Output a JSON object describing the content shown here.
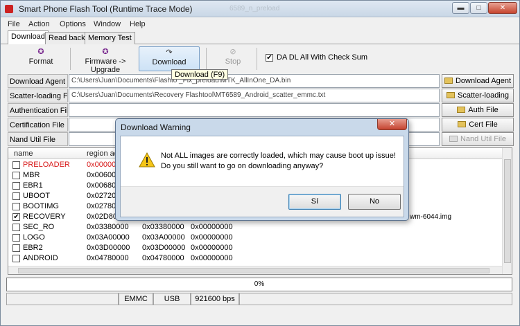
{
  "window": {
    "title": "Smart Phone Flash Tool (Runtime Trace Mode)",
    "ghost_text": "6589_n_preload",
    "min_glyph": "▬",
    "max_glyph": "□",
    "close_glyph": "✕"
  },
  "menu": [
    "File",
    "Action",
    "Options",
    "Window",
    "Help"
  ],
  "tabs": [
    "Download",
    "Read back",
    "Memory Test"
  ],
  "toolbar": {
    "format": "Format",
    "firmware_upgrade": "Firmware -> Upgrade",
    "download": "Download",
    "stop": "Stop",
    "da_dl_checkbox": "DA DL All With Check Sum",
    "da_dl_checked": "✔",
    "tooltip": "Download (F9)"
  },
  "file_rows": [
    {
      "label": "Download Agent",
      "value": "C:\\Users\\Juan\\Documents\\Flashto                     _Fix_preload\\MTK_AllInOne_DA.bin",
      "button": "Download Agent",
      "enabled": true
    },
    {
      "label": "Scatter-loading File",
      "value": "C:\\Users\\Juan\\Documents\\Recovery Flashtool\\MT6589_Android_scatter_emmc.txt",
      "button": "Scatter-loading",
      "enabled": true
    },
    {
      "label": "Authentication File",
      "value": "",
      "button": "Auth File",
      "enabled": true
    },
    {
      "label": "Certification File",
      "value": "",
      "button": "Cert File",
      "enabled": true
    },
    {
      "label": "Nand Util File",
      "value": "",
      "button": "Nand Util File",
      "enabled": false
    }
  ],
  "list": {
    "headers": [
      "name",
      "region ad"
    ],
    "rows": [
      {
        "name": "PRELOADER",
        "c2": "0x000000",
        "c3": "",
        "c4": "",
        "checked": false,
        "red": true
      },
      {
        "name": "MBR",
        "c2": "0x006000",
        "c3": "",
        "c4": "",
        "checked": false,
        "red": false
      },
      {
        "name": "EBR1",
        "c2": "0x006800",
        "c3": "",
        "c4": "",
        "checked": false,
        "red": false
      },
      {
        "name": "UBOOT",
        "c2": "0x027200",
        "c3": "",
        "c4": "",
        "checked": false,
        "red": false
      },
      {
        "name": "BOOTIMG",
        "c2": "0x027800",
        "c3": "",
        "c4": "",
        "checked": false,
        "red": false
      },
      {
        "name": "RECOVERY",
        "c2": "0x02D800",
        "c3": "",
        "c4": "",
        "checked": true,
        "red": false
      },
      {
        "name": "SEC_RO",
        "c2": "0x03380000",
        "c3": "0x03380000",
        "c4": "0x00000000",
        "checked": false,
        "red": false
      },
      {
        "name": "LOGO",
        "c2": "0x03A00000",
        "c3": "0x03A00000",
        "c4": "0x00000000",
        "checked": false,
        "red": false
      },
      {
        "name": "EBR2",
        "c2": "0x03D00000",
        "c3": "0x03D00000",
        "c4": "0x00000000",
        "checked": false,
        "red": false
      },
      {
        "name": "ANDROID",
        "c2": "0x04780000",
        "c3": "0x04780000",
        "c4": "0x00000000",
        "checked": false,
        "red": false
      }
    ],
    "extra_file": "wm-6044.img"
  },
  "progress": {
    "value": 0,
    "text": "0%"
  },
  "status": [
    "",
    "EMMC",
    "USB",
    "921600 bps",
    ""
  ],
  "dialog": {
    "title": "Download Warning",
    "close_glyph": "✕",
    "line1": "Not ALL images are correctly loaded, which may cause boot up issue!",
    "line2": "Do you still want to go on downloading anyway?",
    "yes": "Sí",
    "no": "No"
  },
  "colors": {
    "warning_red": "#d81818",
    "accent_blue": "#3c7fb1"
  }
}
